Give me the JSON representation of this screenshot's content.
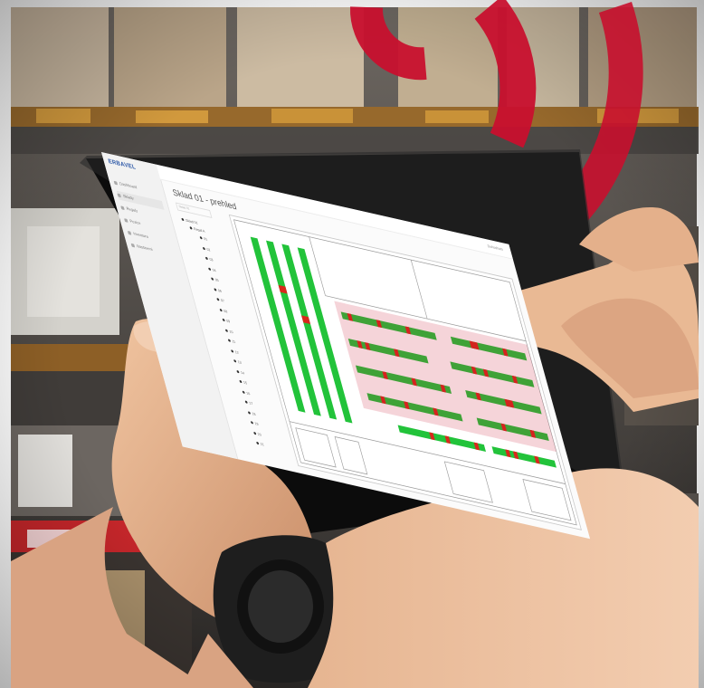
{
  "photo": {
    "subject": "hands holding a tablet in a warehouse aisle",
    "colors": {
      "shelf_dark": "#3a3633",
      "box_tan": "#c9b59a",
      "pallet": "#b8873a",
      "accent_red": "#c8102e",
      "skin": "#e0b08c",
      "watch": "#1d1d1d",
      "tablet_bezel": "#111111"
    }
  },
  "app": {
    "brand": "ERBAVEL",
    "user": "Dohodnuto",
    "page_title": "Sklad 01 - prehled",
    "breadcrumb": "Sklad 01",
    "sidebar_items": [
      {
        "label": "Dashboard",
        "active": false
      },
      {
        "label": "Sklady",
        "active": true
      },
      {
        "label": "Regaly",
        "active": false
      },
      {
        "label": "Pozice",
        "active": false
      },
      {
        "label": "Inventura",
        "active": false
      },
      {
        "label": "Nastaveni",
        "active": false
      }
    ],
    "tree": {
      "root": "Sklad 01",
      "child": "Regal A",
      "leaves": [
        "01",
        "02",
        "03",
        "04",
        "05",
        "06",
        "07",
        "08",
        "09",
        "10",
        "11",
        "12",
        "13",
        "14",
        "15",
        "16",
        "17",
        "18",
        "19",
        "20",
        "21"
      ]
    },
    "map_colors": {
      "occupied": "#22c33a",
      "alert": "#d8281c",
      "line": "#9a9a9a"
    }
  }
}
